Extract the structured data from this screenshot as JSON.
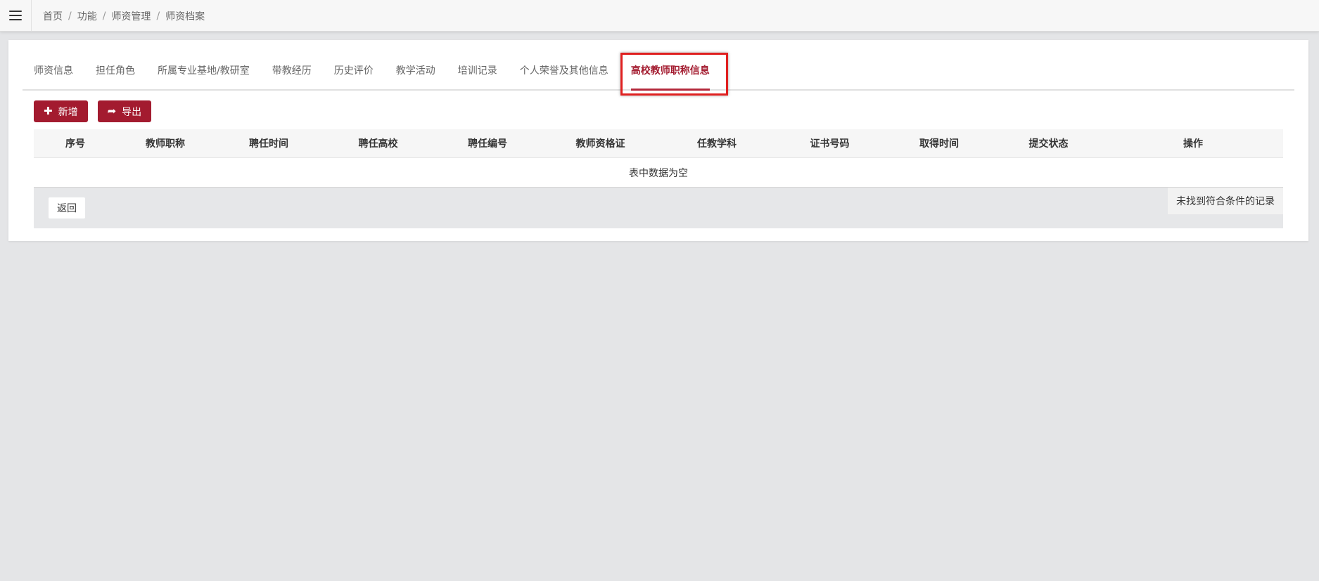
{
  "topbar": {
    "menu_icon": "hamburger-menu-icon",
    "breadcrumb": [
      "首页",
      "功能",
      "师资管理",
      "师资档案"
    ],
    "separator": "/"
  },
  "tabs": [
    {
      "label": "师资信息",
      "active": false
    },
    {
      "label": "担任角色",
      "active": false
    },
    {
      "label": "所属专业基地/教研室",
      "active": false
    },
    {
      "label": "带教经历",
      "active": false
    },
    {
      "label": "历史评价",
      "active": false
    },
    {
      "label": "教学活动",
      "active": false
    },
    {
      "label": "培训记录",
      "active": false
    },
    {
      "label": "个人荣誉及其他信息",
      "active": false
    },
    {
      "label": "高校教师职称信息",
      "active": true
    }
  ],
  "toolbar": {
    "add_label": "新增",
    "add_icon": "plus-icon",
    "export_label": "导出",
    "export_icon": "share-arrow-icon"
  },
  "table": {
    "columns": [
      "序号",
      "教师职称",
      "聘任时间",
      "聘任高校",
      "聘任编号",
      "教师资格证",
      "任教学科",
      "证书号码",
      "取得时间",
      "提交状态",
      "操作"
    ],
    "empty_text": "表中数据为空",
    "no_records_text": "未找到符合条件的记录"
  },
  "footer": {
    "back_label": "返回"
  },
  "colors": {
    "primary": "#a31b2f",
    "highlight_border": "#e02020",
    "page_background": "#e4e5e7"
  }
}
